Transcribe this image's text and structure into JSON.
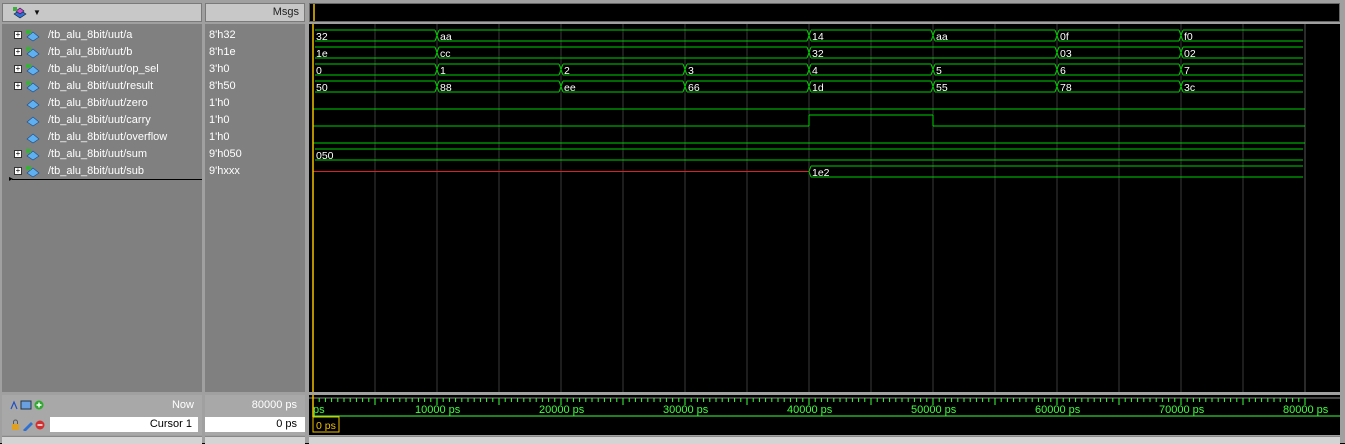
{
  "header": {
    "msgs_label": "Msgs"
  },
  "signals": [
    {
      "name": "/tb_alu_8bit/uut/a",
      "value": "8'h32",
      "expandable": true,
      "icon": "bus-icon",
      "wave": {
        "kind": "bus",
        "color": "#00d000",
        "segments": [
          {
            "start": 0,
            "label": "32"
          },
          {
            "start": 10000,
            "label": "aa"
          },
          {
            "start": 40000,
            "label": "14"
          },
          {
            "start": 50000,
            "label": "aa"
          },
          {
            "start": 60000,
            "label": "0f"
          },
          {
            "start": 70000,
            "label": "f0"
          }
        ]
      }
    },
    {
      "name": "/tb_alu_8bit/uut/b",
      "value": "8'h1e",
      "expandable": true,
      "icon": "bus-icon",
      "wave": {
        "kind": "bus",
        "color": "#00d000",
        "segments": [
          {
            "start": 0,
            "label": "1e"
          },
          {
            "start": 10000,
            "label": "cc"
          },
          {
            "start": 40000,
            "label": "32"
          },
          {
            "start": 60000,
            "label": "03"
          },
          {
            "start": 70000,
            "label": "02"
          }
        ]
      }
    },
    {
      "name": "/tb_alu_8bit/uut/op_sel",
      "value": "3'h0",
      "expandable": true,
      "icon": "bus-icon",
      "wave": {
        "kind": "bus",
        "color": "#00d000",
        "segments": [
          {
            "start": 0,
            "label": "0"
          },
          {
            "start": 10000,
            "label": "1"
          },
          {
            "start": 20000,
            "label": "2"
          },
          {
            "start": 30000,
            "label": "3"
          },
          {
            "start": 40000,
            "label": "4"
          },
          {
            "start": 50000,
            "label": "5"
          },
          {
            "start": 60000,
            "label": "6"
          },
          {
            "start": 70000,
            "label": "7"
          }
        ]
      }
    },
    {
      "name": "/tb_alu_8bit/uut/result",
      "value": "8'h50",
      "expandable": true,
      "icon": "bus-icon",
      "wave": {
        "kind": "bus",
        "color": "#00d000",
        "segments": [
          {
            "start": 0,
            "label": "50"
          },
          {
            "start": 10000,
            "label": "88"
          },
          {
            "start": 20000,
            "label": "ee"
          },
          {
            "start": 30000,
            "label": "66"
          },
          {
            "start": 40000,
            "label": "1d"
          },
          {
            "start": 50000,
            "label": "55"
          },
          {
            "start": 60000,
            "label": "78"
          },
          {
            "start": 70000,
            "label": "3c"
          }
        ]
      }
    },
    {
      "name": "/tb_alu_8bit/uut/zero",
      "value": "1'h0",
      "expandable": false,
      "icon": "wire-icon",
      "wave": {
        "kind": "bit",
        "color": "#00d000",
        "segments": [
          {
            "start": 0,
            "level": 0
          }
        ]
      }
    },
    {
      "name": "/tb_alu_8bit/uut/carry",
      "value": "1'h0",
      "expandable": false,
      "icon": "wire-icon",
      "wave": {
        "kind": "bit",
        "color": "#00d000",
        "segments": [
          {
            "start": 0,
            "level": 0
          },
          {
            "start": 40000,
            "level": 1
          },
          {
            "start": 50000,
            "level": 0
          }
        ]
      }
    },
    {
      "name": "/tb_alu_8bit/uut/overflow",
      "value": "1'h0",
      "expandable": false,
      "icon": "wire-icon",
      "wave": {
        "kind": "bit",
        "color": "#00d000",
        "segments": [
          {
            "start": 0,
            "level": 0
          }
        ]
      }
    },
    {
      "name": "/tb_alu_8bit/uut/sum",
      "value": "9'h050",
      "expandable": true,
      "icon": "bus-icon",
      "wave": {
        "kind": "bus",
        "color": "#00d000",
        "segments": [
          {
            "start": 0,
            "label": "050"
          }
        ]
      }
    },
    {
      "name": "/tb_alu_8bit/uut/sub",
      "value": "9'hxxx",
      "expandable": true,
      "icon": "bus-icon",
      "wave": {
        "kind": "busx",
        "color": "#00d000",
        "xcolor": "#e02020",
        "segments": [
          {
            "start": 0,
            "label": "",
            "unknown": true
          },
          {
            "start": 40000,
            "label": "1e2"
          }
        ]
      }
    }
  ],
  "time": {
    "end": 80000,
    "ticks": [
      {
        "t": 0,
        "label": "ps"
      },
      {
        "t": 10000,
        "label": "10000 ps"
      },
      {
        "t": 20000,
        "label": "20000 ps"
      },
      {
        "t": 30000,
        "label": "30000 ps"
      },
      {
        "t": 40000,
        "label": "40000 ps"
      },
      {
        "t": 50000,
        "label": "50000 ps"
      },
      {
        "t": 60000,
        "label": "60000 ps"
      },
      {
        "t": 70000,
        "label": "70000 ps"
      },
      {
        "t": 80000,
        "label": "80000 ps"
      }
    ],
    "grid_step": 5000
  },
  "footer": {
    "now_label": "Now",
    "now_value": "80000 ps",
    "cursor_label": "Cursor 1",
    "cursor_value": "0 ps",
    "cursor_time_label": "0 ps",
    "cursor_time": 0
  },
  "colors": {
    "wave": "#00d000",
    "unknown": "#e02020",
    "cursor": "#f0c000",
    "grid": "#3a3a3a",
    "timeline_text": "#3dff3d"
  }
}
